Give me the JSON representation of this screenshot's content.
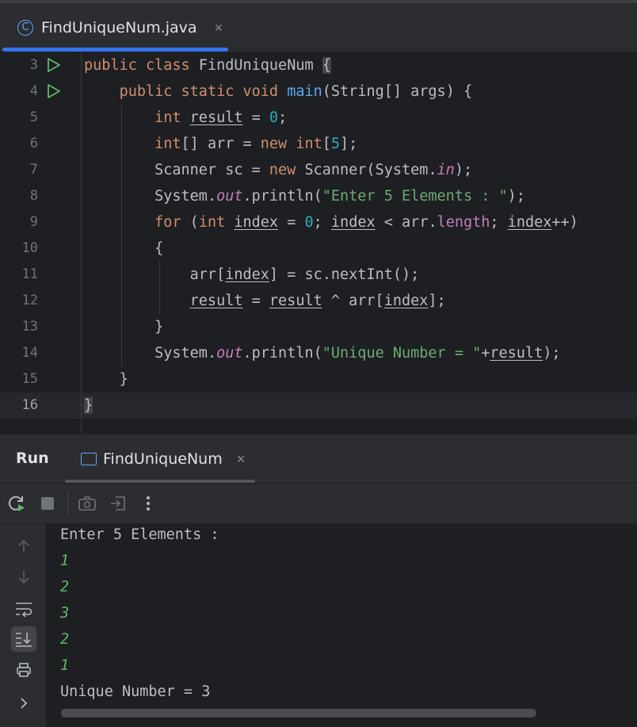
{
  "editor_tab": {
    "icon": "class-icon",
    "icon_glyph": "C",
    "label": "FindUniqueNum.java",
    "close": "×"
  },
  "editor": {
    "lines": [
      {
        "num": "3",
        "run": true
      },
      {
        "num": "4",
        "run": true
      },
      {
        "num": "5"
      },
      {
        "num": "6"
      },
      {
        "num": "7"
      },
      {
        "num": "8"
      },
      {
        "num": "9"
      },
      {
        "num": "10"
      },
      {
        "num": "11"
      },
      {
        "num": "12"
      },
      {
        "num": "13"
      },
      {
        "num": "14"
      },
      {
        "num": "15"
      },
      {
        "num": "16",
        "current": true
      }
    ],
    "code": {
      "l3": {
        "kw1": "public",
        "kw2": "class",
        "name": "FindUniqueNum",
        "brace": "{"
      },
      "l4": {
        "kw1": "public",
        "kw2": "static",
        "kw3": "void",
        "fn": "main",
        "rest": "(String[] args) {"
      },
      "l5": {
        "type": "int",
        "var": "result",
        "eq": " = ",
        "val": "0",
        "end": ";"
      },
      "l6": {
        "type": "int",
        "t1": "[] arr = ",
        "kw": "new",
        "sp": " ",
        "type2": "int",
        "b1": "[",
        "val": "5",
        "b2": "];"
      },
      "l7": {
        "t1": "Scanner sc = ",
        "kw": "new",
        "t2": " Scanner(System.",
        "fld": "in",
        "t3": ");"
      },
      "l8": {
        "t1": "System.",
        "fld": "out",
        "t2": ".println(",
        "str": "\"Enter 5 Elements : \"",
        "t3": ");"
      },
      "l9": {
        "kw": "for",
        "t1": " (",
        "type": "int",
        "sp": " ",
        "v1": "index",
        "t2": " = ",
        "val": "0",
        "t3": "; ",
        "v2": "index",
        "t4": " < arr.",
        "prop": "length",
        "t5": "; ",
        "v3": "index",
        "t6": "++)"
      },
      "l10": {
        "t": "{"
      },
      "l11": {
        "t1": "arr[",
        "v": "index",
        "t2": "] = sc.nextInt();"
      },
      "l12": {
        "v1": "result",
        "t1": " = ",
        "v2": "result",
        "t2": " ^ arr[",
        "v3": "index",
        "t3": "];"
      },
      "l13": {
        "t": "}"
      },
      "l14": {
        "t1": "System.",
        "fld": "out",
        "t2": ".println(",
        "str": "\"Unique Number = \"",
        "t3": "+",
        "v": "result",
        "t4": ");"
      },
      "l15": {
        "t": "}"
      },
      "l16": {
        "t": "}"
      }
    }
  },
  "run_panel": {
    "title": "Run",
    "tab_icon": "console-icon",
    "tab_label": "FindUniqueNum",
    "tab_close": "×",
    "toolbar_icons": [
      "rerun-icon",
      "stop-icon",
      "screenshot-icon",
      "exit-icon",
      "more-icon"
    ],
    "side_icons": [
      "up-arrow-icon",
      "down-arrow-icon",
      "soft-wrap-icon",
      "scroll-to-end-icon",
      "print-icon",
      "expand-icon"
    ],
    "console": [
      {
        "text": "Enter 5 Elements :",
        "kind": "out"
      },
      {
        "text": "1",
        "kind": "in"
      },
      {
        "text": "2",
        "kind": "in"
      },
      {
        "text": "3",
        "kind": "in"
      },
      {
        "text": "2",
        "kind": "in"
      },
      {
        "text": "1",
        "kind": "in"
      },
      {
        "text": "Unique Number = 3",
        "kind": "out"
      }
    ]
  },
  "colors": {
    "accent": "#3574f0",
    "keyword": "#cf8e6d",
    "function": "#56a8f5",
    "string": "#6aab73",
    "number": "#2aacb8",
    "field": "#c77dbb",
    "input": "#5fb865"
  }
}
